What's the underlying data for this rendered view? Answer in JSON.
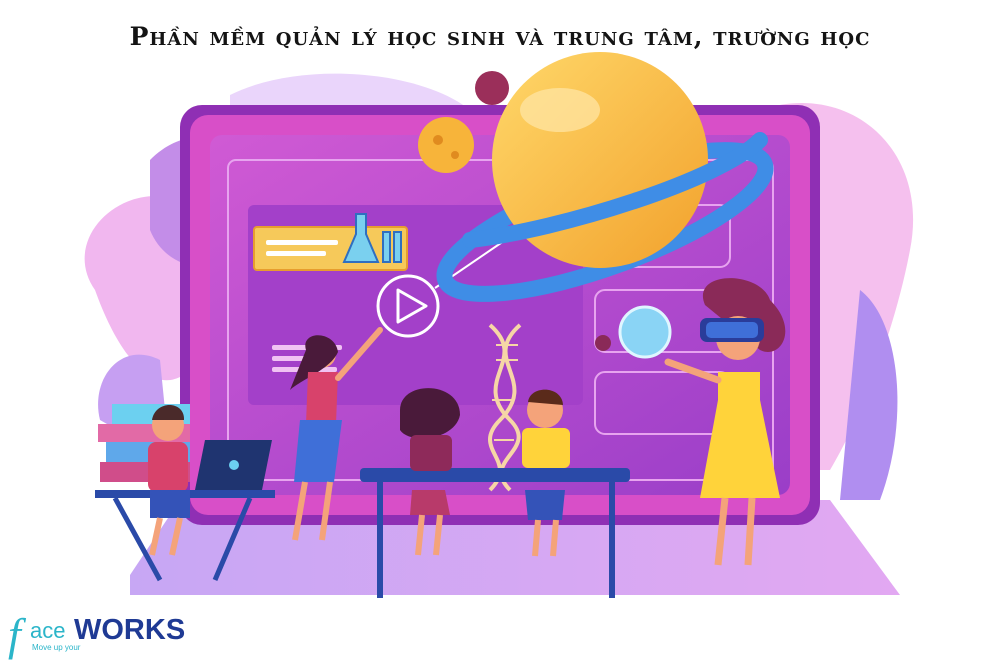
{
  "headline": "Phần mềm quản lý học sinh và trung tâm, trường học",
  "logo": {
    "f": "f",
    "ace": "ace",
    "works": "WORKS",
    "tagline": "Move up your"
  },
  "colors": {
    "board_frame": "#d84fc8",
    "board_screen": "#b847cf",
    "planet": "#fbbf3f",
    "ring": "#3f8de6",
    "desk": "#2a4aa8",
    "logo_teal": "#2bb5c9",
    "logo_navy": "#1f3a94"
  },
  "icons": [
    "play-icon",
    "flask-icon",
    "dna-icon",
    "planet-icon",
    "vr-headset-icon",
    "laptop-icon"
  ]
}
